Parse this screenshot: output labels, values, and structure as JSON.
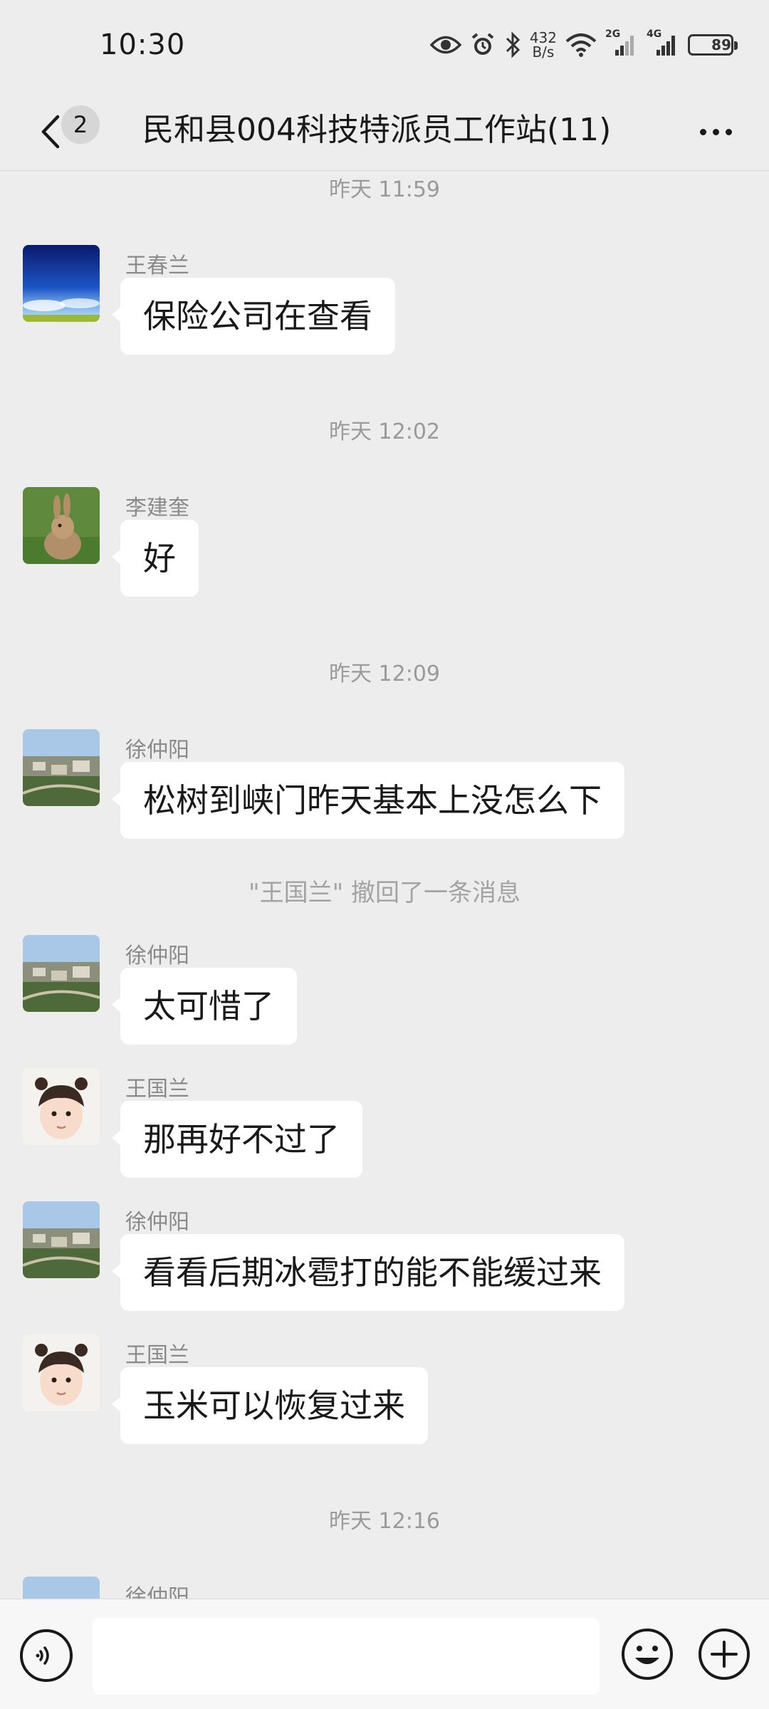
{
  "status_bar": {
    "time": "10:30",
    "net_speed_value": "432",
    "net_speed_unit": "B/s",
    "sim1_label": "2G",
    "sim2_label": "4G",
    "battery": "89",
    "icons": [
      "eye-icon",
      "alarm-icon",
      "bluetooth-icon",
      "wifi-icon",
      "signal-2g-icon",
      "signal-4g-icon",
      "battery-icon"
    ]
  },
  "header": {
    "unread_count": "2",
    "title": "民和县004科技特派员工作站(11)"
  },
  "messages": [
    {
      "type": "time",
      "text": "昨天 11:59"
    },
    {
      "type": "msg",
      "sender": "王春兰",
      "text": "保险公司在查看",
      "avatar": "sky"
    },
    {
      "type": "time",
      "text": "昨天 12:02"
    },
    {
      "type": "msg",
      "sender": "李建奎",
      "text": "好",
      "avatar": "rabbit"
    },
    {
      "type": "time",
      "text": "昨天 12:09"
    },
    {
      "type": "msg",
      "sender": "徐仲阳",
      "text": "松树到峡门昨天基本上没怎么下",
      "avatar": "town"
    },
    {
      "type": "system",
      "text": "\"王国兰\" 撤回了一条消息"
    },
    {
      "type": "msg",
      "sender": "徐仲阳",
      "text": "太可惜了",
      "avatar": "town"
    },
    {
      "type": "msg",
      "sender": "王国兰",
      "text": "那再好不过了",
      "avatar": "child"
    },
    {
      "type": "msg",
      "sender": "徐仲阳",
      "text": "看看后期冰雹打的能不能缓过来",
      "avatar": "town"
    },
    {
      "type": "msg",
      "sender": "王国兰",
      "text": "玉米可以恢复过来",
      "avatar": "child"
    },
    {
      "type": "time",
      "text": "昨天 12:16"
    },
    {
      "type": "msg",
      "sender": "徐仲阳",
      "text": "",
      "avatar": "town"
    }
  ],
  "input_bar": {
    "value": "",
    "icons": [
      "voice-icon",
      "emoji-icon",
      "plus-icon"
    ]
  },
  "colors": {
    "background": "#ededed",
    "bubble": "#ffffff",
    "timestamp": "#9a9a9a",
    "sender": "#8a8a8a"
  }
}
